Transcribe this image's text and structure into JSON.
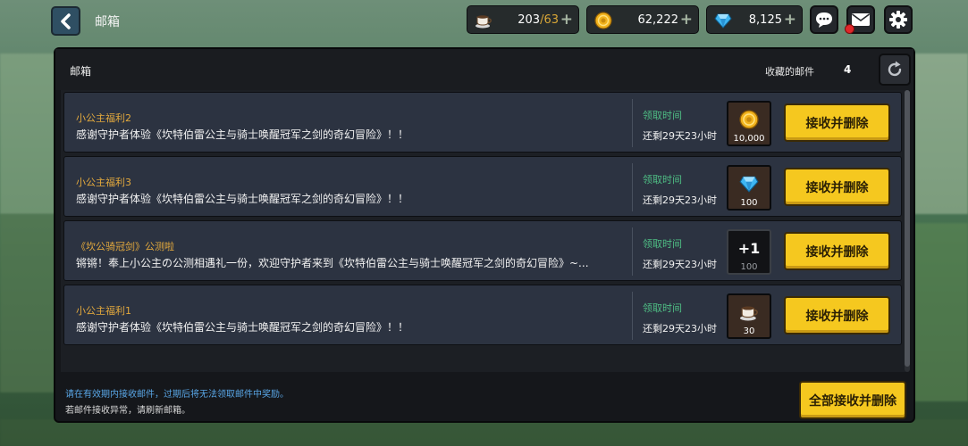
{
  "header": {
    "title": "邮箱",
    "currencies": [
      {
        "name": "stamina",
        "icon": "coffee-cup-icon",
        "value": "203",
        "max": "/63"
      },
      {
        "name": "gold",
        "icon": "gold-coin-icon",
        "value": "62,222"
      },
      {
        "name": "gems",
        "icon": "diamond-icon",
        "value": "8,125"
      }
    ],
    "plus_glyph": "+"
  },
  "panel": {
    "title": "邮箱",
    "favorites_label": "收藏的邮件",
    "favorites_count": "4"
  },
  "mails": [
    {
      "sender": "小公主福利2",
      "text": "感谢守护者体验《坎特伯雷公主与骑士唤醒冠军之剑的奇幻冒险》！！",
      "claim_label": "领取时间",
      "remaining": "还剩29天23小时",
      "reward_icon": "gold-coin-icon",
      "reward_qty": "10,000",
      "button": "接收并删除"
    },
    {
      "sender": "小公主福利3",
      "text": "感谢守护者体验《坎特伯雷公主与骑士唤醒冠军之剑的奇幻冒险》！！",
      "claim_label": "领取时间",
      "remaining": "还剩29天23小时",
      "reward_icon": "diamond-icon",
      "reward_qty": "100",
      "button": "接收并删除"
    },
    {
      "sender": "《坎公骑冠剑》公测啦",
      "text": "锵锵！奉上小公主の公测相遇礼一份，欢迎守护者来到《坎特伯雷公主与骑士唤醒冠军之剑的奇幻冒险》~...",
      "claim_label": "领取时间",
      "remaining": "还剩29天23小时",
      "reward_icon": "plus-one-icon",
      "reward_label": "+1",
      "reward_qty": "100",
      "button": "接收并删除"
    },
    {
      "sender": "小公主福利1",
      "text": "感谢守护者体验《坎特伯雷公主与骑士唤醒冠军之剑的奇幻冒险》！！",
      "claim_label": "领取时间",
      "remaining": "还剩29天23小时",
      "reward_icon": "coffee-cup-icon",
      "reward_qty": "30",
      "button": "接收并删除"
    }
  ],
  "footer": {
    "notice": "请在有效期内接收邮件，过期后将无法领取邮件中奖励。",
    "hint": "若邮件接收异常，请刷新邮箱。",
    "claim_all": "全部接收并删除"
  },
  "colors": {
    "accent_yellow": "#f5c81f",
    "sender_orange": "#e3a93d",
    "claim_green": "#4fbf85",
    "notice_blue": "#59a6e6"
  }
}
